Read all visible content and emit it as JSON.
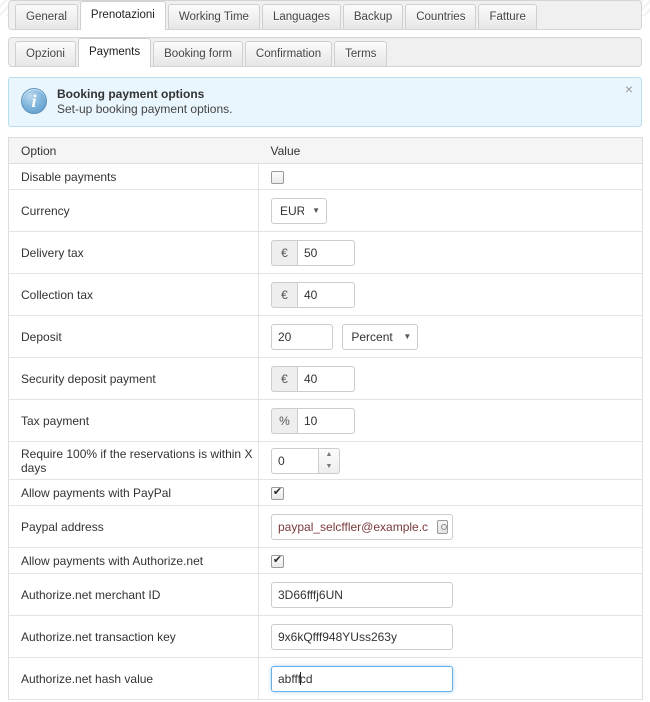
{
  "primary_tabs": [
    {
      "label": "General",
      "active": false
    },
    {
      "label": "Prenotazioni",
      "active": true
    },
    {
      "label": "Working Time",
      "active": false
    },
    {
      "label": "Languages",
      "active": false
    },
    {
      "label": "Backup",
      "active": false
    },
    {
      "label": "Countries",
      "active": false
    },
    {
      "label": "Fatture",
      "active": false
    }
  ],
  "secondary_tabs": [
    {
      "label": "Opzioni",
      "active": false
    },
    {
      "label": "Payments",
      "active": true
    },
    {
      "label": "Booking form",
      "active": false
    },
    {
      "label": "Confirmation",
      "active": false
    },
    {
      "label": "Terms",
      "active": false
    }
  ],
  "alert": {
    "icon": "info-circle-icon",
    "title": "Booking payment options",
    "subtitle": "Set-up booking payment options.",
    "close_label": "×",
    "bg_color": "#eaf6fd",
    "border_color": "#b9def0"
  },
  "table": {
    "headers": {
      "option": "Option",
      "value": "Value"
    },
    "rows": [
      {
        "label": "Disable payments",
        "control": "checkbox",
        "checked": false
      },
      {
        "label": "Currency",
        "control": "select",
        "value": "EUR"
      },
      {
        "label": "Delivery tax",
        "control": "addon-input",
        "addon": "€",
        "value": "50"
      },
      {
        "label": "Collection tax",
        "control": "addon-input",
        "addon": "€",
        "value": "40"
      },
      {
        "label": "Deposit",
        "control": "input-select",
        "value": "20",
        "select_value": "Percent"
      },
      {
        "label": "Security deposit payment",
        "control": "addon-input",
        "addon": "€",
        "value": "40"
      },
      {
        "label": "Tax payment",
        "control": "addon-input",
        "addon": "%",
        "value": "10"
      },
      {
        "label": "Require 100% if the reservations is within X days",
        "control": "spinner",
        "value": "0"
      },
      {
        "label": "Allow payments with PayPal",
        "control": "checkbox",
        "checked": true
      },
      {
        "label": "Paypal address",
        "control": "autofill-input",
        "value": "paypal_selcffler@example.com",
        "icon": "key-manager-icon"
      },
      {
        "label": "Allow payments with Authorize.net",
        "control": "checkbox",
        "checked": true
      },
      {
        "label": "Authorize.net merchant ID",
        "control": "text",
        "value": "3D66fffj6UN"
      },
      {
        "label": "Authorize.net transaction key",
        "control": "text",
        "value": "9x6kQfff948YUss263y"
      },
      {
        "label": "Authorize.net hash value",
        "control": "text-focused",
        "value_before_caret": "abfff",
        "value_after_caret": "cd",
        "value": "abfffcd"
      }
    ]
  },
  "colors": {
    "accent": "#66afe9",
    "tab_active_bg": "#ffffff",
    "tabbar_bg": "#f0f0f0",
    "table_header_bg": "#f5f5f5",
    "border": "#dddddd"
  }
}
